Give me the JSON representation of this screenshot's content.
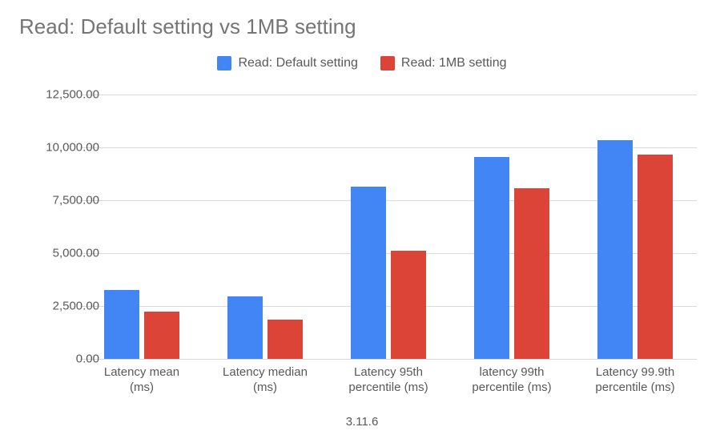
{
  "chart_data": {
    "type": "bar",
    "title": "Read: Default setting vs 1MB setting",
    "xlabel": "3.11.6",
    "ylabel": "",
    "ylim": [
      0,
      12500
    ],
    "y_ticks": [
      0,
      2500,
      5000,
      7500,
      10000,
      12500
    ],
    "y_tick_labels": [
      "0.00",
      "2,500.00",
      "5,000.00",
      "7,500.00",
      "10,000.00",
      "12,500.00"
    ],
    "categories": [
      "Latency mean (ms)",
      "Latency median (ms)",
      "Latency 95th percentile (ms)",
      "latency 99th percentile (ms)",
      "Latency 99.9th percentile (ms)"
    ],
    "series": [
      {
        "name": "Read: Default setting",
        "color": "#4285f4",
        "values": [
          3250,
          2950,
          8150,
          9550,
          10350
        ]
      },
      {
        "name": "Read: 1MB setting",
        "color": "#db4437",
        "values": [
          2250,
          1850,
          5100,
          8050,
          9650
        ]
      }
    ]
  }
}
